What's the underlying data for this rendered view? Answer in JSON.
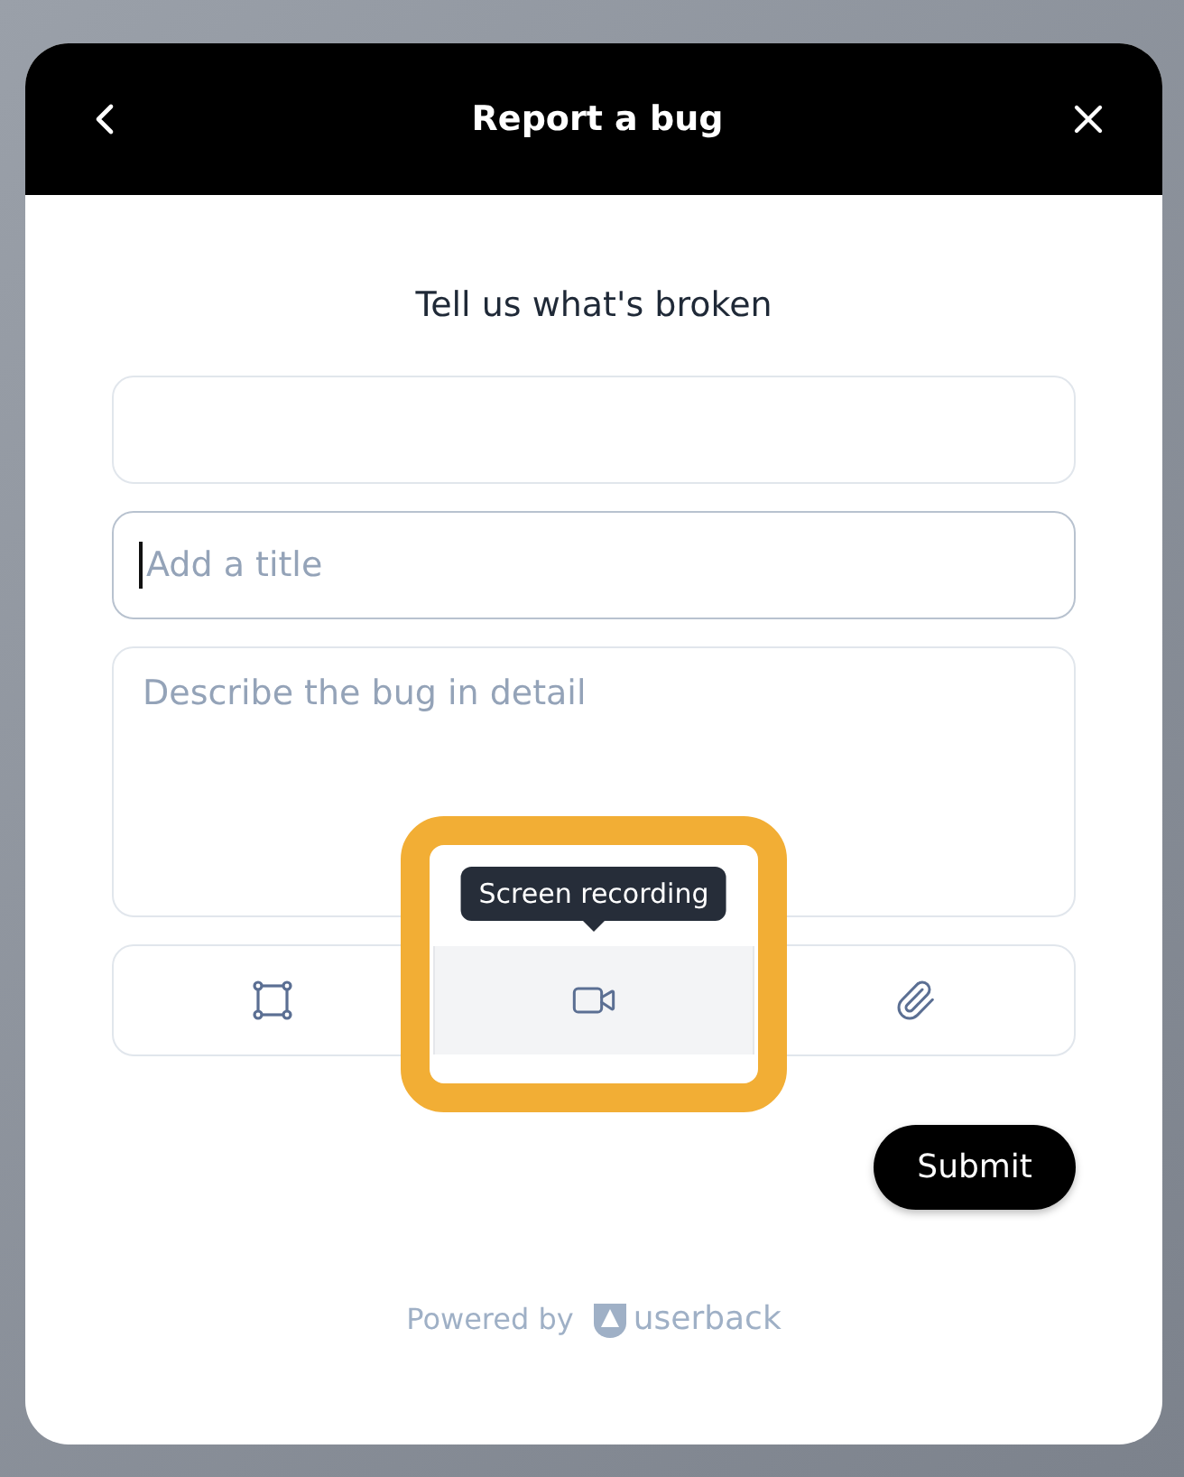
{
  "header": {
    "title": "Report a bug"
  },
  "heading": "Tell us what's broken",
  "fields": [
    {
      "kind": "input",
      "focused": false
    },
    {
      "kind": "input",
      "placeholder": "Add a title",
      "focused": true
    },
    {
      "kind": "textarea",
      "placeholder": "Describe the bug in detail",
      "focused": false
    }
  ],
  "tools": [
    {
      "kind": "screenshot",
      "highlighted": false
    },
    {
      "kind": "video",
      "highlighted": true,
      "tooltip": "Screen recording"
    },
    {
      "kind": "attach",
      "highlighted": false
    }
  ],
  "submit": "Submit",
  "footer": {
    "label": "Powered by",
    "brand": "userback"
  }
}
